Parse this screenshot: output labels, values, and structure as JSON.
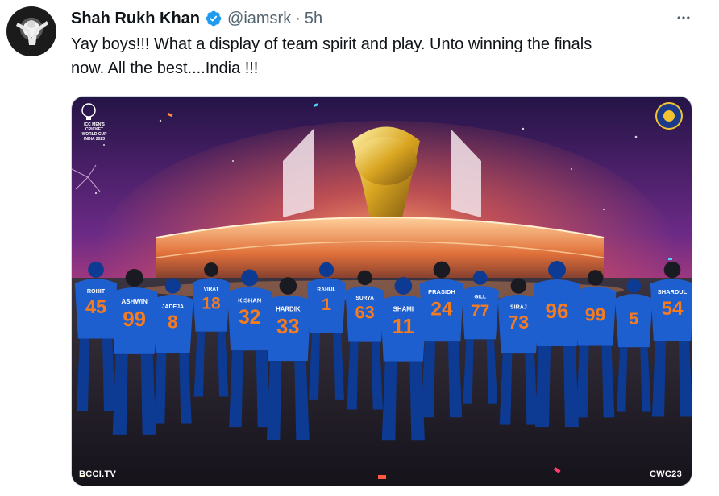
{
  "tweet": {
    "author_name": "Shah Rukh Khan",
    "handle": "@iamsrk",
    "separator": "·",
    "time": "5h",
    "text": "Yay boys!!! What a display of team spirit and play. Unto winning the finals\nnow. All the best....India !!!",
    "verified_icon": "verified-badge-icon",
    "more_icon": "more-dots-icon"
  },
  "media": {
    "watermark_left": "BCCI.TV",
    "watermark_right": "CWC23",
    "cwc_logo_text": "ICC MEN'S CRICKET WORLD CUP INDIA 2023",
    "players": [
      {
        "name": "ROHIT",
        "number": "45"
      },
      {
        "name": "ASHWIN",
        "number": "99"
      },
      {
        "name": "JADEJA",
        "number": "8"
      },
      {
        "name": "VIRAT",
        "number": "18"
      },
      {
        "name": "KISHAN",
        "number": "32"
      },
      {
        "name": "HARDIK",
        "number": "33"
      },
      {
        "name": "RAHUL",
        "number": "1"
      },
      {
        "name": "SURYA",
        "number": "63"
      },
      {
        "name": "SHAMI",
        "number": "11"
      },
      {
        "name": "PRASIDH",
        "number": "24"
      },
      {
        "name": "GILL",
        "number": "77"
      },
      {
        "name": "SIRAJ",
        "number": "73"
      },
      {
        "name": "",
        "number": "96"
      },
      {
        "name": "",
        "number": "99"
      },
      {
        "name": "",
        "number": "5"
      },
      {
        "name": "SHARDUL",
        "number": "54"
      }
    ],
    "colors": {
      "jersey": "#1e5fcf",
      "jersey_dark": "#0d3a92",
      "number": "#f47b20",
      "sky_top": "#2a1a55",
      "sky_mid": "#7b2f8c",
      "glow": "#ff6a3d"
    }
  }
}
